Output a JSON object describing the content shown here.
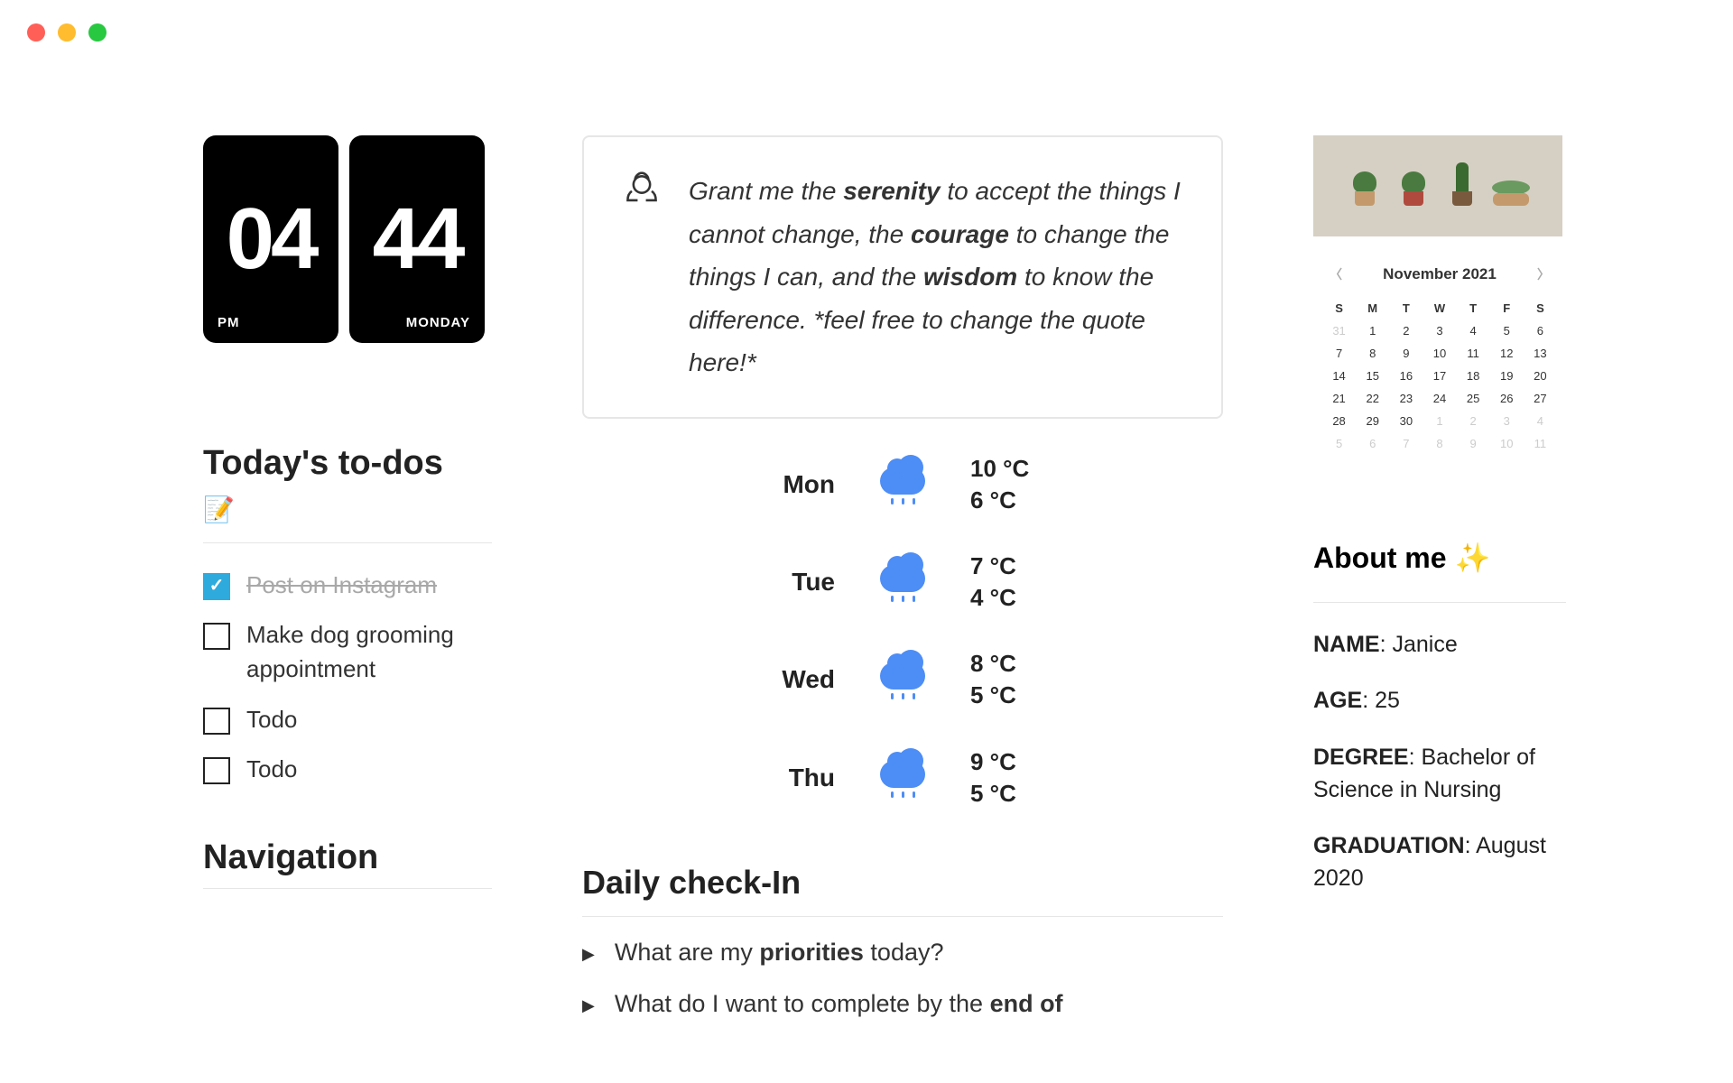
{
  "clock": {
    "hour": "04",
    "minute": "44",
    "ampm": "PM",
    "day": "MONDAY"
  },
  "todos_title": "Today's to-dos",
  "todos_emoji": "📝",
  "todos": [
    {
      "label": "Post on Instagram",
      "done": true
    },
    {
      "label": "Make dog grooming appointment",
      "done": false
    },
    {
      "label": "Todo",
      "done": false
    },
    {
      "label": "Todo",
      "done": false
    }
  ],
  "navigation_title": "Navigation",
  "quote": {
    "p1": "Grant me the ",
    "b1": "serenity",
    "p2": " to accept the things I cannot change, the ",
    "b2": "courage",
    "p3": " to change the things I can, and the ",
    "b3": "wisdom",
    "p4": " to know the difference. *feel free to change the quote here!*"
  },
  "weather": [
    {
      "day": "Mon",
      "hi": "10 °C",
      "lo": "6 °C"
    },
    {
      "day": "Tue",
      "hi": "7 °C",
      "lo": "4 °C"
    },
    {
      "day": "Wed",
      "hi": "8 °C",
      "lo": "5 °C"
    },
    {
      "day": "Thu",
      "hi": "9 °C",
      "lo": "5 °C"
    }
  ],
  "checkin_title": "Daily check-In",
  "checkin": {
    "q1a": "What are my ",
    "q1b": "priorities",
    "q1c": " today?",
    "q2a": "What do I want to complete by the ",
    "q2b": "end of"
  },
  "calendar": {
    "month": "November 2021",
    "dow": [
      "S",
      "M",
      "T",
      "W",
      "T",
      "F",
      "S"
    ],
    "grid": [
      {
        "n": "31",
        "m": true
      },
      {
        "n": "1"
      },
      {
        "n": "2"
      },
      {
        "n": "3"
      },
      {
        "n": "4"
      },
      {
        "n": "5"
      },
      {
        "n": "6"
      },
      {
        "n": "7"
      },
      {
        "n": "8"
      },
      {
        "n": "9"
      },
      {
        "n": "10"
      },
      {
        "n": "11"
      },
      {
        "n": "12"
      },
      {
        "n": "13"
      },
      {
        "n": "14"
      },
      {
        "n": "15"
      },
      {
        "n": "16"
      },
      {
        "n": "17"
      },
      {
        "n": "18"
      },
      {
        "n": "19"
      },
      {
        "n": "20"
      },
      {
        "n": "21"
      },
      {
        "n": "22"
      },
      {
        "n": "23"
      },
      {
        "n": "24"
      },
      {
        "n": "25"
      },
      {
        "n": "26"
      },
      {
        "n": "27"
      },
      {
        "n": "28"
      },
      {
        "n": "29"
      },
      {
        "n": "30"
      },
      {
        "n": "1",
        "m": true
      },
      {
        "n": "2",
        "m": true
      },
      {
        "n": "3",
        "m": true
      },
      {
        "n": "4",
        "m": true
      },
      {
        "n": "5",
        "m": true
      },
      {
        "n": "6",
        "m": true
      },
      {
        "n": "7",
        "m": true
      },
      {
        "n": "8",
        "m": true
      },
      {
        "n": "9",
        "m": true
      },
      {
        "n": "10",
        "m": true
      },
      {
        "n": "11",
        "m": true
      }
    ]
  },
  "about": {
    "title": "About me ✨",
    "name_label": "NAME",
    "name_val": ": Janice",
    "age_label": "AGE",
    "age_val": ": 25",
    "degree_label": "DEGREE",
    "degree_val": ": Bachelor of Science in Nursing",
    "grad_label": "GRADUATION",
    "grad_val": ": August 2020"
  }
}
